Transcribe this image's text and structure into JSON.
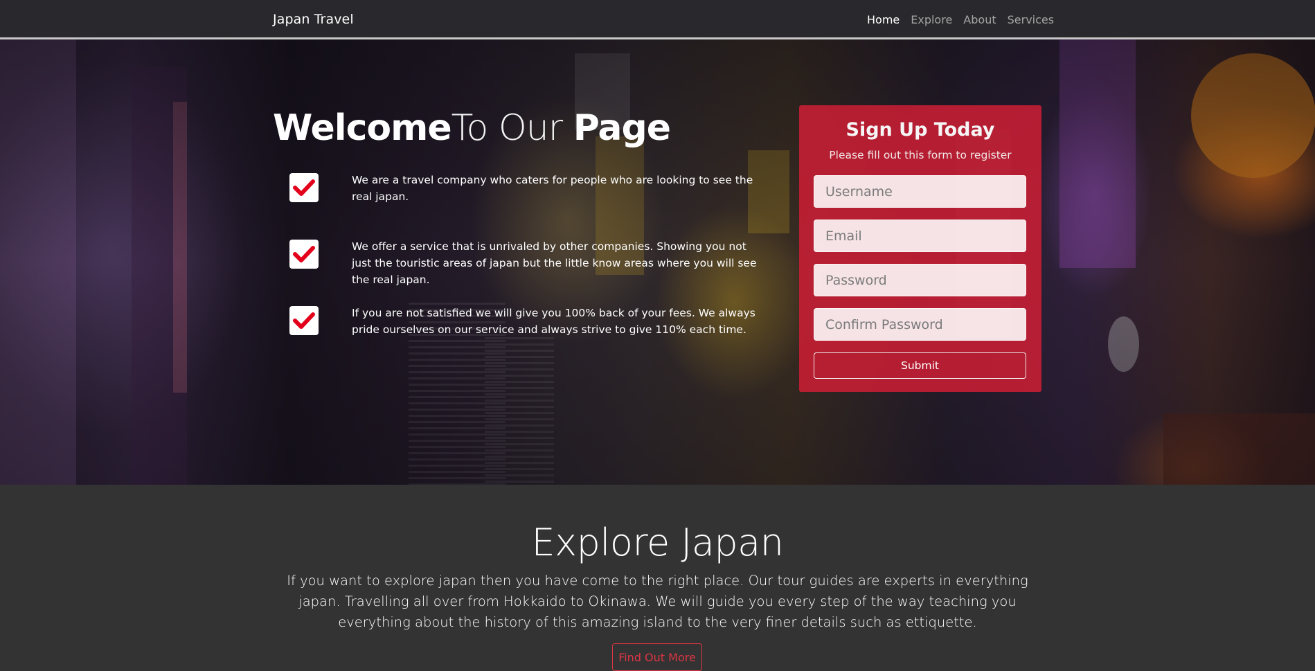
{
  "navbar": {
    "brand": "Japan Travel",
    "links": [
      {
        "label": "Home",
        "active": true
      },
      {
        "label": "Explore",
        "active": false
      },
      {
        "label": "About",
        "active": false
      },
      {
        "label": "Services",
        "active": false
      }
    ]
  },
  "hero": {
    "title_part1": "Welcome",
    "title_part2": "To Our ",
    "title_part3": "Page",
    "features": [
      {
        "icon": "checkmark-icon",
        "text": "We are a travel company who caters for people who are looking to see the real japan."
      },
      {
        "icon": "checkmark-icon",
        "text": "We offer a service that is unrivaled by other companies. Showing you not just the touristic areas of japan but the little know areas where you will see the real japan."
      },
      {
        "icon": "checkmark-icon",
        "text": "If you are not satisfied we will give you 100% back of your fees. We always pride ourselves on our service and always strive to give 110% each time."
      }
    ]
  },
  "signup": {
    "title": "Sign Up Today",
    "subtitle": "Please fill out this form to register",
    "username_placeholder": "Username",
    "email_placeholder": "Email",
    "password_placeholder": "Password",
    "confirm_placeholder": "Confirm Password",
    "submit_label": "Submit"
  },
  "explore": {
    "title": "Explore Japan",
    "text": "If you want to explore japan then you have come to the right place. Our tour guides are experts in everything japan. Travelling all over from Hokkaido to Okinawa. We will guide you every step of the way teaching you everything about the history of this amazing island to the very finer details such as ettiquette.",
    "button_label": "Find Out More"
  },
  "colors": {
    "accent_red": "#dc3545",
    "card_red": "#cd1e34",
    "check_red": "#e3001b",
    "section_bg": "#333333"
  }
}
